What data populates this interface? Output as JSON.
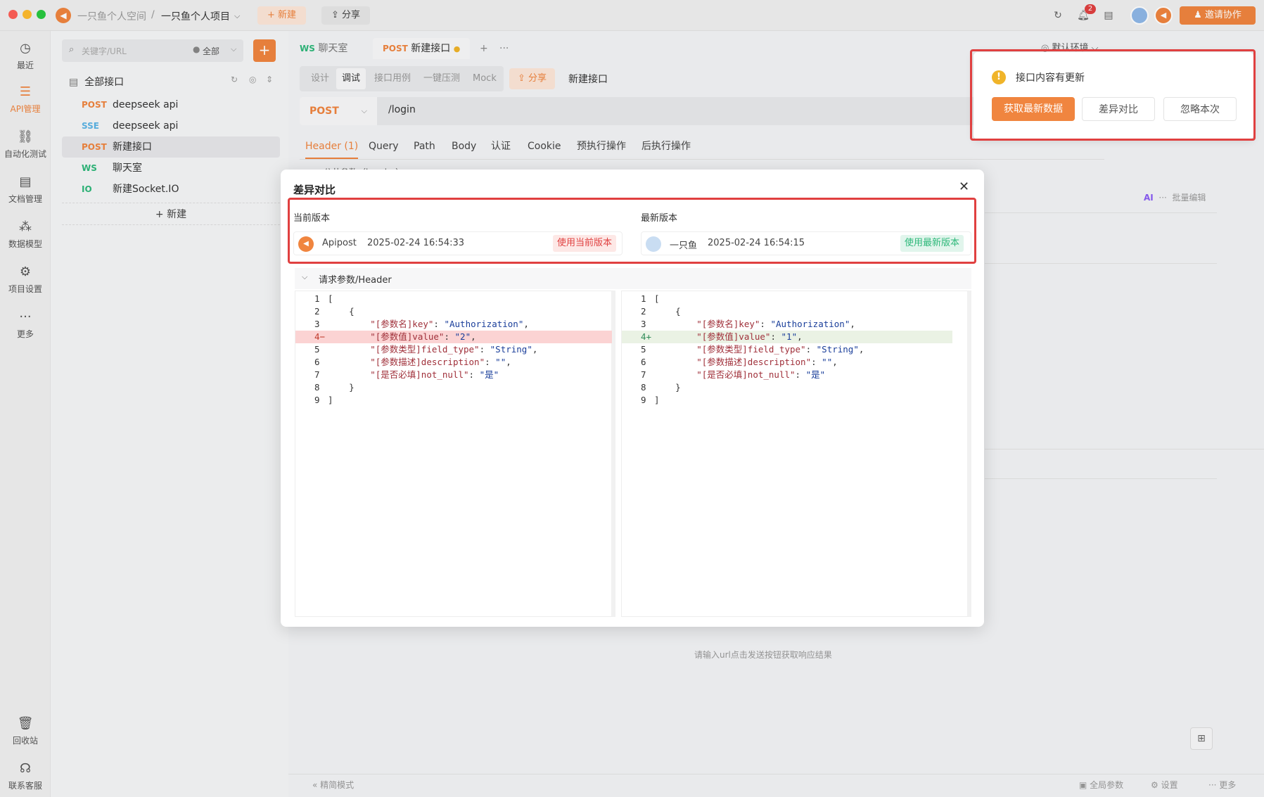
{
  "topbar": {
    "space": "一只鱼个人空间",
    "sep": "/",
    "project": "一只鱼个人项目",
    "new_label": "+ 新建",
    "share_label": "分享",
    "badge": "2",
    "invite_label": "邀请协作"
  },
  "nav": [
    {
      "label": "最近",
      "icon": "clock-icon",
      "glyph": "◷"
    },
    {
      "label": "API管理",
      "icon": "api-icon",
      "glyph": "☰"
    },
    {
      "label": "自动化测试",
      "icon": "flow-icon",
      "glyph": "⛓"
    },
    {
      "label": "文档管理",
      "icon": "doc-icon",
      "glyph": "▤"
    },
    {
      "label": "数据模型",
      "icon": "model-icon",
      "glyph": "⁂"
    },
    {
      "label": "项目设置",
      "icon": "settings-icon",
      "glyph": "⚙"
    },
    {
      "label": "更多",
      "icon": "more-icon",
      "glyph": "···"
    },
    {
      "label": "回收站",
      "icon": "trash-icon",
      "glyph": "🗑"
    },
    {
      "label": "联系客服",
      "icon": "headset-icon",
      "glyph": "☊"
    }
  ],
  "tree": {
    "search_placeholder": "关键字/URL",
    "filter": "全部",
    "root": "全部接口",
    "items": [
      {
        "method": "POST",
        "name": "deepseek api",
        "color": "#f0853f"
      },
      {
        "method": "SSE",
        "name": "deepseek api",
        "color": "#5bb4e5"
      },
      {
        "method": "POST",
        "name": "新建接口",
        "color": "#f0853f"
      },
      {
        "method": "WS",
        "name": "聊天室",
        "color": "#2eb87a"
      },
      {
        "method": "IO",
        "name": "新建Socket.IO",
        "color": "#2eb87a"
      }
    ],
    "new_label": "新建"
  },
  "tabs": [
    {
      "method": "WS",
      "name": "聊天室"
    },
    {
      "method": "POST",
      "name": "新建接口"
    }
  ],
  "env": "默认环境",
  "subtabs": [
    "设计",
    "调试",
    "接口用例",
    "一键压测",
    "Mock"
  ],
  "share_btn": "分享",
  "api_name": "新建接口",
  "url": {
    "method": "POST",
    "path": "/login"
  },
  "param_tabs": [
    "Header (1)",
    "Query",
    "Path",
    "Body",
    "认证",
    "Cookie",
    "预执行操作",
    "后执行操作"
  ],
  "batch_edit": "批量编辑",
  "public_params": "公共参数（header）",
  "response_hint": "请输入url点击发送按钮获取响应结果",
  "modal": {
    "title": "差异对比",
    "current_label": "当前版本",
    "latest_label": "最新版本",
    "current_user": "Apipost",
    "current_time": "2025-02-24 16:54:33",
    "current_btn": "使用当前版本",
    "latest_user": "一只鱼",
    "latest_time": "2025-02-24 16:54:15",
    "latest_btn": "使用最新版本",
    "section": "请求参数/Header",
    "left_code": [
      {
        "n": "1",
        "t": "["
      },
      {
        "n": "2",
        "t": "    {"
      },
      {
        "n": "3",
        "t": "        \"[参数名]key\": \"Authorization\","
      },
      {
        "n": "4",
        "t": "        \"[参数值]value\": \"2\",",
        "mark": "−"
      },
      {
        "n": "5",
        "t": "        \"[参数类型]field_type\": \"String\","
      },
      {
        "n": "6",
        "t": "        \"[参数描述]description\": \"\","
      },
      {
        "n": "7",
        "t": "        \"[是否必填]not_null\": \"是\""
      },
      {
        "n": "8",
        "t": "    }"
      },
      {
        "n": "9",
        "t": "]"
      }
    ],
    "right_code": [
      {
        "n": "1",
        "t": "["
      },
      {
        "n": "2",
        "t": "    {"
      },
      {
        "n": "3",
        "t": "        \"[参数名]key\": \"Authorization\","
      },
      {
        "n": "4",
        "t": "        \"[参数值]value\": \"1\",",
        "mark": "+"
      },
      {
        "n": "5",
        "t": "        \"[参数类型]field_type\": \"String\","
      },
      {
        "n": "6",
        "t": "        \"[参数描述]description\": \"\","
      },
      {
        "n": "7",
        "t": "        \"[是否必填]not_null\": \"是\""
      },
      {
        "n": "8",
        "t": "    }"
      },
      {
        "n": "9",
        "t": "]"
      }
    ]
  },
  "notif": {
    "message": "接口内容有更新",
    "btn_fetch": "获取最新数据",
    "btn_diff": "差异对比",
    "btn_ignore": "忽略本次"
  },
  "footer": {
    "mode": "精简模式",
    "global": "全局参数",
    "settings": "设置",
    "more": "更多"
  },
  "colors": {
    "accent": "#f0853f",
    "green": "#2eb87a",
    "red": "#e04040"
  }
}
